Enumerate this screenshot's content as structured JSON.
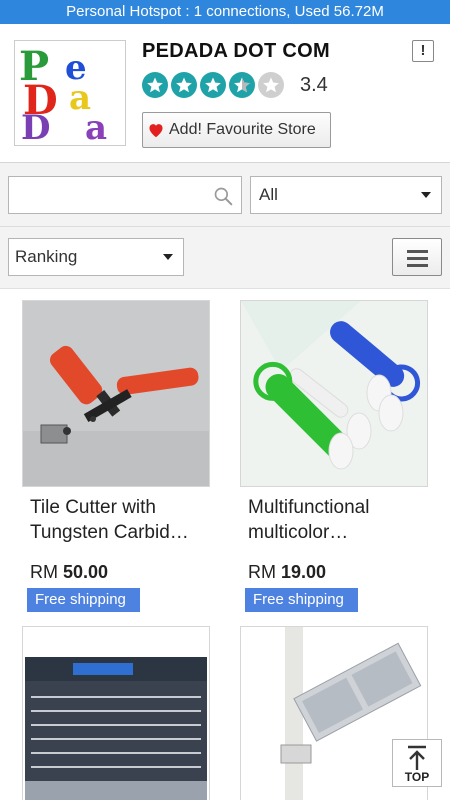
{
  "status_bar": {
    "text": "Personal Hotspot : 1 connections, Used 56.72M"
  },
  "store": {
    "logo_text": "PeDaDa",
    "name": "PEDADA DOT COM",
    "alert_label": "!",
    "rating": "3.4",
    "rating_value": 3.4,
    "stars_max": 5,
    "favourite_label": "Add! Favourite Store",
    "colors": {
      "star_filled": "#1fa3a8",
      "star_empty": "#cfcfcf",
      "heart": "#e32020"
    }
  },
  "search": {
    "value": "",
    "placeholder": "",
    "category_selected": "All"
  },
  "sort": {
    "selected": "Ranking"
  },
  "products": [
    {
      "title": "Tile Cutter with Tungsten Carbid…",
      "currency": "RM",
      "price": "50.00",
      "badge": "Free shipping"
    },
    {
      "title": "Multifunctional multicolor…",
      "currency": "RM",
      "price": "19.00",
      "badge": "Free shipping"
    },
    {
      "title": "",
      "currency": "",
      "price": "",
      "badge": ""
    },
    {
      "title": "",
      "currency": "",
      "price": "",
      "badge": ""
    }
  ],
  "scroll_top": {
    "label": "TOP"
  },
  "accent_color": "#2f86dd",
  "badge_color": "#4e82e0"
}
